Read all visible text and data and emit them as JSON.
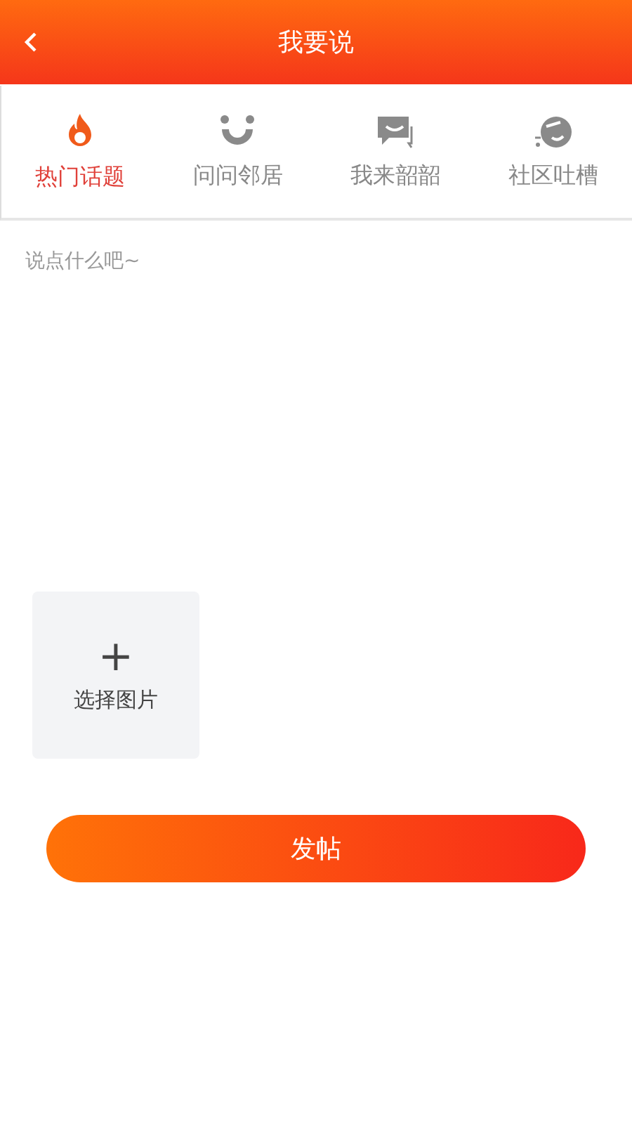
{
  "header": {
    "title": "我要说"
  },
  "tabs": [
    {
      "label": "热门话题",
      "kind": "fire",
      "selected": true
    },
    {
      "label": "问问邻居",
      "kind": "smile",
      "selected": false
    },
    {
      "label": "我来韶韶",
      "kind": "chat",
      "selected": false
    },
    {
      "label": "社区吐槽",
      "kind": "face",
      "selected": false
    }
  ],
  "post": {
    "placeholder": "说点什么吧~"
  },
  "image_picker": {
    "plus": "+",
    "label": "选择图片"
  },
  "submit": {
    "label": "发帖"
  }
}
